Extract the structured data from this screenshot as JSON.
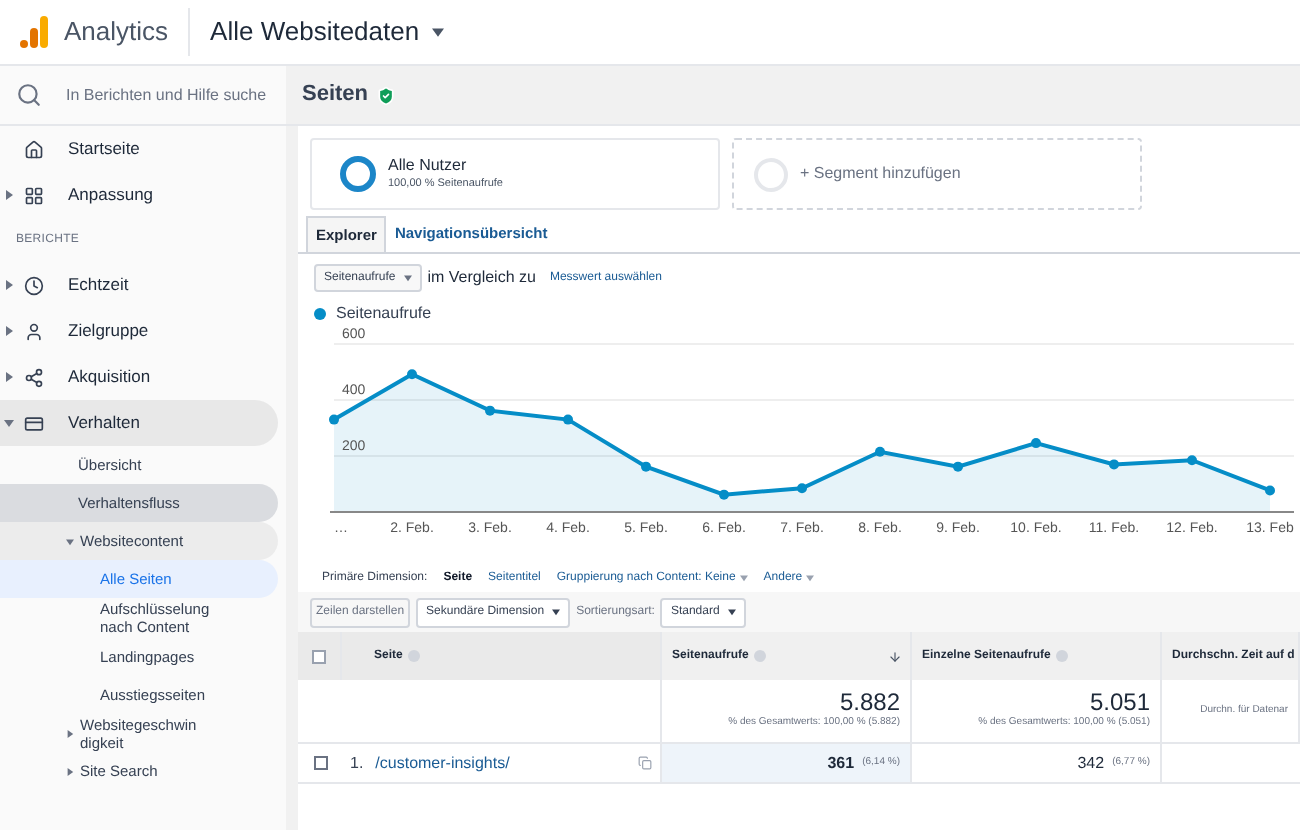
{
  "header": {
    "product": "Analytics",
    "view": "Alle Websitedaten"
  },
  "sidebar": {
    "search": {
      "placeholder": "In Berichten und Hilfe suche"
    },
    "items": [
      {
        "kind": "nav",
        "label": "Startseite",
        "expandable": false,
        "expanded": false
      },
      {
        "kind": "nav",
        "label": "Anpassung",
        "expandable": true,
        "expanded": false
      },
      {
        "kind": "section",
        "label": "BERICHTE"
      },
      {
        "kind": "nav",
        "label": "Echtzeit",
        "expandable": true,
        "expanded": false
      },
      {
        "kind": "nav",
        "label": "Zielgruppe",
        "expandable": true,
        "expanded": false
      },
      {
        "kind": "nav",
        "label": "Akquisition",
        "expandable": true,
        "expanded": false
      },
      {
        "kind": "nav",
        "label": "Verhalten",
        "expandable": true,
        "expanded": true,
        "children": [
          {
            "label": "Übersicht",
            "expandable": false,
            "expanded": false,
            "highlighted": false
          },
          {
            "label": "Verhaltensfluss",
            "expandable": false,
            "expanded": false,
            "highlighted": true
          },
          {
            "label": "Websitecontent",
            "expandable": true,
            "expanded": true,
            "highlighted": false,
            "children": [
              {
                "label": "Alle Seiten",
                "selected": true
              },
              {
                "label": "Aufschlüsselung nach Content",
                "selected": false
              },
              {
                "label": "Landingpages",
                "selected": false
              },
              {
                "label": "Ausstiegsseiten",
                "selected": false
              }
            ]
          },
          {
            "label": "Websitegeschwin digkeit",
            "expandable": true,
            "expanded": false,
            "highlighted": false
          },
          {
            "label": "Site Search",
            "expandable": true,
            "expanded": false,
            "highlighted": false
          }
        ]
      }
    ]
  },
  "page": {
    "title": "Seiten",
    "verified": true
  },
  "segments": [
    {
      "kind": "active",
      "title": "Alle Nutzer",
      "subtitle": "100,00 % Seitenaufrufe"
    },
    {
      "kind": "add",
      "title": "+ Segment hinzufügen"
    }
  ],
  "tabs": [
    {
      "label": "Explorer",
      "selected": true
    },
    {
      "label": "Navigationsübersicht",
      "selected": false
    }
  ],
  "metric": {
    "value": "Seitenaufrufe",
    "compare_label": "im Vergleich zu",
    "compare_link": "Messwert auswählen"
  },
  "chart": {
    "chart_data": {
      "type": "area",
      "categories": [
        "…",
        "2. Feb.",
        "3. Feb.",
        "4. Feb.",
        "5. Feb.",
        "6. Feb.",
        "7. Feb.",
        "8. Feb.",
        "9. Feb.",
        "10. Feb.",
        "11. Feb.",
        "12. Feb.",
        "13. Feb"
      ],
      "series": [
        {
          "name": "Seitenaufrufe",
          "color": "#058dc7",
          "values": [
            330,
            492,
            362,
            330,
            162,
            62,
            85,
            215,
            162,
            246,
            170,
            185,
            77
          ]
        }
      ],
      "ylim": [
        0,
        600
      ],
      "yticks": [
        200,
        400,
        600
      ]
    }
  },
  "dimensions": {
    "label": "Primäre Dimension:",
    "options": [
      {
        "label": "Seite",
        "selected": true,
        "dropdown": false
      },
      {
        "label": "Seitentitel",
        "selected": false,
        "dropdown": false
      },
      {
        "label": "Gruppierung nach Content: Keine",
        "selected": false,
        "dropdown": true
      },
      {
        "label": "Andere",
        "selected": false,
        "dropdown": true
      }
    ]
  },
  "toolbar": {
    "plot_button": "Zeilen darstellen",
    "plot_disabled": true,
    "secondary": "Sekundäre Dimension",
    "sort_label": "Sortierungsart:",
    "sort_value": "Standard"
  },
  "table": {
    "select_all_checked": false,
    "columns": [
      {
        "label": "Seite",
        "help": true,
        "sorted": false
      },
      {
        "label": "Seitenaufrufe",
        "help": true,
        "sorted": true
      },
      {
        "label": "Einzelne Seitenaufrufe",
        "help": true,
        "sorted": false
      },
      {
        "label": "Durchschn. Zeit auf d"
      }
    ],
    "totals": [
      {
        "value": "5.882",
        "note": "% des Gesamtwerts: 100,00 % (5.882)"
      },
      {
        "value": "5.051",
        "note": "% des Gesamtwerts: 100,00 % (5.051)"
      },
      {
        "note": "Durchn. für Datenar"
      }
    ],
    "rows": [
      {
        "index": "1.",
        "page": "/customer-insights/",
        "checked": false,
        "views": "361",
        "views_pct": "(6,14 %)",
        "unique": "342",
        "unique_pct": "(6,77 %)"
      }
    ]
  }
}
